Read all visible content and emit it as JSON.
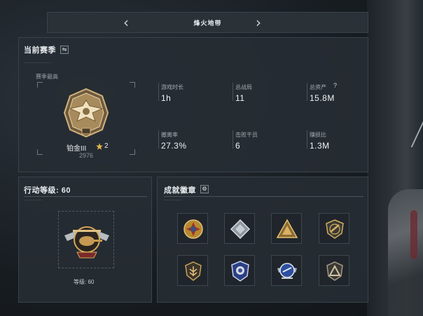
{
  "header": {
    "title": "烽火地带",
    "prev": "‹",
    "next": "›"
  },
  "season": {
    "title": "当前赛季",
    "best_label": "赛季最高",
    "rank_name": "铂金III",
    "rank_stars": "2",
    "rank_score": "2976",
    "stats": [
      {
        "label": "游戏时长",
        "value": "1h"
      },
      {
        "label": "总战局",
        "value": "11"
      },
      {
        "label": "总资产",
        "value": "15.8M"
      },
      {
        "label": "撤离率",
        "value": "27.3%"
      },
      {
        "label": "击败干员",
        "value": "6"
      },
      {
        "label": "赚损比",
        "value": "1.3M"
      }
    ],
    "asset_help": "?"
  },
  "action_level": {
    "title": "行动等级: 60",
    "level_label": "等级: 60"
  },
  "achievements": {
    "title": "成就徽章",
    "badges": [
      {
        "icon": "red-cross-emblem-icon"
      },
      {
        "icon": "silver-diamond-emblem-icon"
      },
      {
        "icon": "gold-triangle-emblem-icon"
      },
      {
        "icon": "gold-shield-emblem-icon"
      },
      {
        "icon": "gold-leaf-shield-icon"
      },
      {
        "icon": "blue-shield-emblem-icon"
      },
      {
        "icon": "blue-winged-emblem-icon"
      },
      {
        "icon": "grey-triangle-shield-icon"
      }
    ]
  }
}
